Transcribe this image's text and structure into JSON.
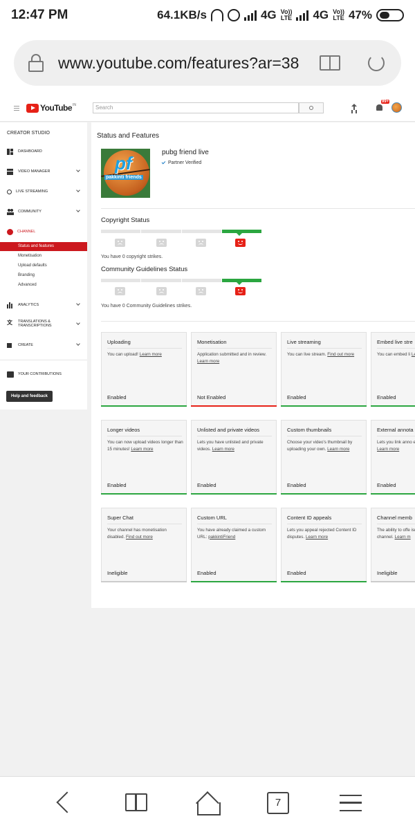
{
  "status_bar": {
    "time": "12:47 PM",
    "speed": "64.1KB/s",
    "net1": "4G",
    "net2": "4G",
    "volte_top": "Vo))",
    "volte_bottom": "LTE",
    "battery": "47%"
  },
  "browser": {
    "url": "www.youtube.com/features?ar=38"
  },
  "youtube": {
    "logo_text": "YouTube",
    "region": "IN",
    "search_placeholder": "Search",
    "notif_count": "99+"
  },
  "sidebar": {
    "title": "CREATOR STUDIO",
    "items": [
      {
        "label": "DASHBOARD"
      },
      {
        "label": "VIDEO MANAGER"
      },
      {
        "label": "LIVE STREAMING"
      },
      {
        "label": "COMMUNITY"
      },
      {
        "label": "CHANNEL"
      },
      {
        "label": "ANALYTICS"
      },
      {
        "label": "TRANSLATIONS &"
      },
      {
        "label": "CREATE"
      },
      {
        "label": "YOUR CONTRIBUTIONS"
      }
    ],
    "translations_line2": "TRANSCRIPTIONS",
    "channel_sub": [
      {
        "label": "Status and features"
      },
      {
        "label": "Monetisation"
      },
      {
        "label": "Upload defaults"
      },
      {
        "label": "Branding"
      },
      {
        "label": "Advanced"
      }
    ],
    "help_button": "Help and feedback"
  },
  "main": {
    "title": "Status and Features",
    "channel_name": "pubg friend live",
    "verified": "Partner Verified",
    "thumb_logo": "pf",
    "thumb_caption": "pakkinti friends",
    "copyright_title": "Copyright Status",
    "copyright_text": "You have 0 copyright strikes.",
    "guidelines_title": "Community Guidelines Status",
    "guidelines_text": "You have 0 Community Guidelines strikes."
  },
  "cards": [
    {
      "title": "Uploading",
      "desc": "You can upload!",
      "link": "Learn more",
      "status": "Enabled",
      "color": "#2ba640"
    },
    {
      "title": "Monetisation",
      "desc": "Application submitted and in review.",
      "link": "Learn more",
      "status": "Not Enabled",
      "color": "#e62117"
    },
    {
      "title": "Live streaming",
      "desc": "You can live stream.",
      "link": "Find out more",
      "status": "Enabled",
      "color": "#2ba640"
    },
    {
      "title": "Embed live stre",
      "desc": "You can embed li",
      "link": "Learn more",
      "status": "Enabled",
      "color": "#2ba640"
    },
    {
      "title": "Longer videos",
      "desc": "You can now upload videos longer than 15 minutes!",
      "link": "Learn more",
      "status": "Enabled",
      "color": "#2ba640"
    },
    {
      "title": "Unlisted and private videos",
      "desc": "Lets you have unlisted and private videos.",
      "link": "Learn more",
      "status": "Enabled",
      "color": "#2ba640"
    },
    {
      "title": "Custom thumbnails",
      "desc": "Choose your video's thumbnail by uploading your own.",
      "link": "Learn more",
      "status": "Enabled",
      "color": "#2ba640"
    },
    {
      "title": "External annota",
      "desc": "Lets you link anno external sites or r",
      "link": "Learn more",
      "status": "Enabled",
      "color": "#2ba640"
    },
    {
      "title": "Super Chat",
      "desc": "Your channel has monetisation disabled.",
      "link": "Find out more",
      "status": "Ineligible",
      "color": "#cccccc"
    },
    {
      "title": "Custom URL",
      "desc": "You have already claimed a custom URL:",
      "link": "pakkintiFriend",
      "status": "Enabled",
      "color": "#2ba640"
    },
    {
      "title": "Content ID appeals",
      "desc": "Lets you appeal rejected Content ID disputes.",
      "link": "Learn more",
      "status": "Enabled",
      "color": "#2ba640"
    },
    {
      "title": "Channel memb",
      "desc": "The ability to offe isn't yet available channel.",
      "link": "Learn m",
      "status": "Ineligible",
      "color": "#cccccc"
    }
  ],
  "bottom_nav": {
    "tab_count": "7"
  }
}
